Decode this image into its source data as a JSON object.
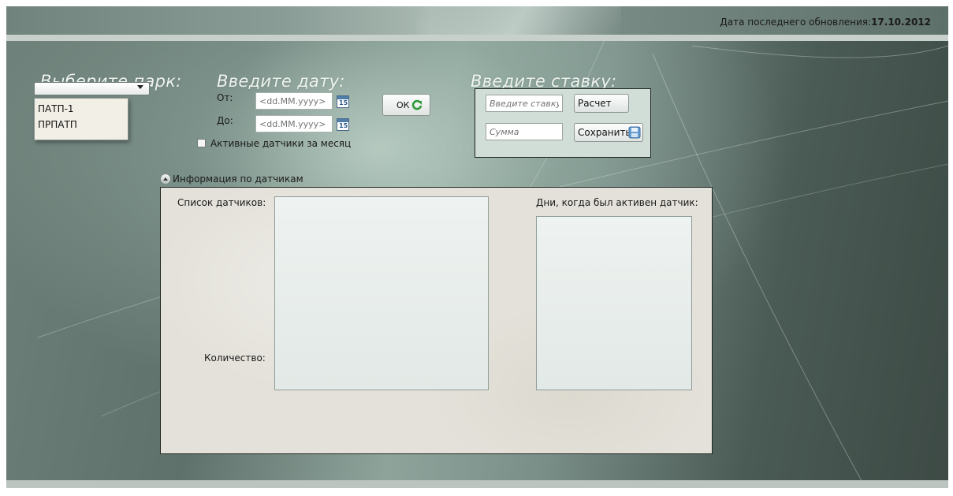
{
  "header": {
    "update_label": "Дата последнего обновления:",
    "update_date": "17.10.2012"
  },
  "park": {
    "title": "Выберите парк:",
    "selected": "",
    "options": [
      "ПАТП-1",
      "ПРПАТП"
    ]
  },
  "date": {
    "title": "Введите дату:",
    "from_label": "От:",
    "to_label": "До:",
    "from_placeholder": "<dd.MM.yyyy>",
    "to_placeholder": "<dd.MM.yyyy>",
    "calendar_day": "15",
    "active_checkbox_label": "Активные датчики за месяц",
    "active_checked": false
  },
  "ok_button": {
    "label": "ОК"
  },
  "rate": {
    "title": "Введите ставку:",
    "rate_placeholder": "Введите ставку",
    "sum_placeholder": "Сумма",
    "calc_label": "Расчет",
    "save_label": "Сохранить"
  },
  "info": {
    "expander_label": "Информация по датчикам",
    "sensors_label": "Список датчиков:",
    "count_label": "Количество:",
    "active_days_label": "Дни, когда был активен датчик:",
    "sensors": [],
    "active_days": []
  },
  "colors": {
    "accent_blue": "#4d7da8",
    "ok_icon_green": "#2f9a3a"
  }
}
